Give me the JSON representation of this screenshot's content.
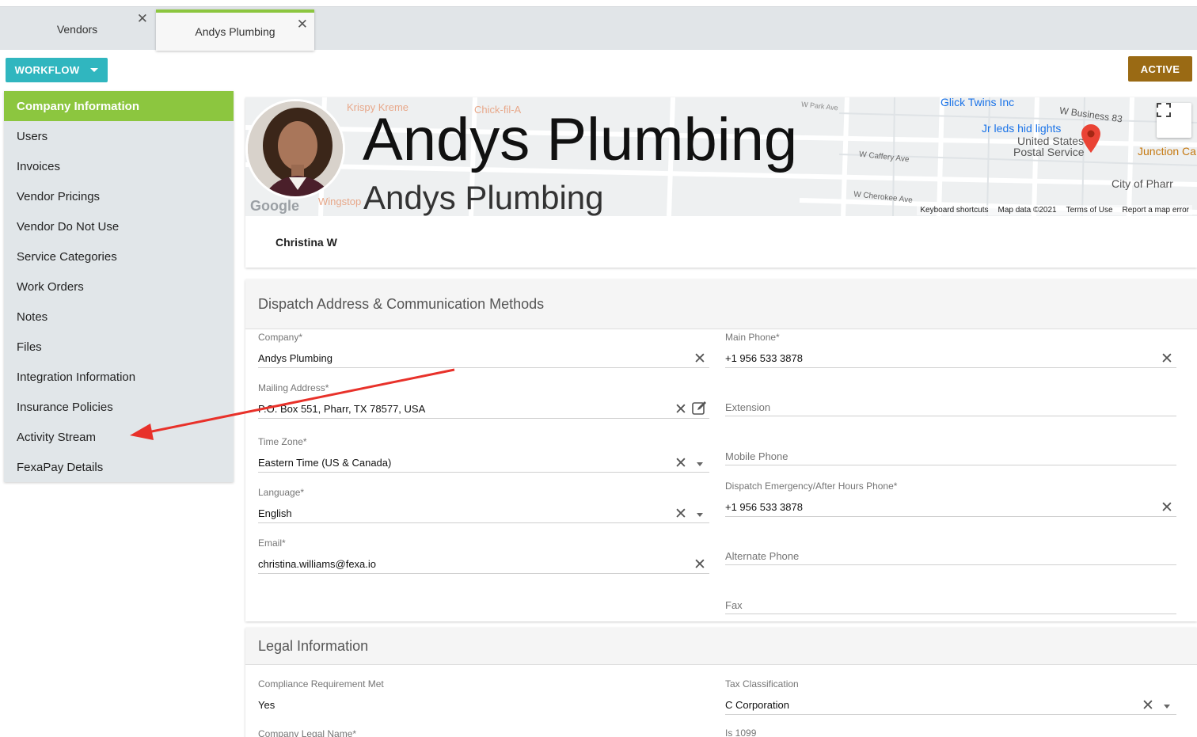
{
  "tabs": [
    {
      "label": "Vendors"
    },
    {
      "label": "Andys Plumbing"
    }
  ],
  "toolbar": {
    "workflow_label": "WORKFLOW",
    "status_label": "ACTIVE"
  },
  "sidebar": {
    "items": [
      {
        "label": "Company Information"
      },
      {
        "label": "Users"
      },
      {
        "label": "Invoices"
      },
      {
        "label": "Vendor Pricings"
      },
      {
        "label": "Vendor Do Not Use"
      },
      {
        "label": "Service Categories"
      },
      {
        "label": "Work Orders"
      },
      {
        "label": "Notes"
      },
      {
        "label": "Files"
      },
      {
        "label": "Integration Information"
      },
      {
        "label": "Insurance Policies"
      },
      {
        "label": "Activity Stream"
      },
      {
        "label": "FexaPay Details"
      }
    ]
  },
  "header": {
    "title": "Andys Plumbing",
    "subtitle": "Andys Plumbing",
    "contact_name": "Christina W"
  },
  "map": {
    "labels": {
      "krispy": "Krispy Kreme",
      "chick": "Chick-fil-A",
      "glick": "Glick Twins Inc",
      "jrleds": "Jr leds hid lights",
      "usps1": "United States",
      "usps2": "Postal Service",
      "junction": "Junction Ca",
      "cityofpharr": "City of Pharr",
      "wingstop": "Wingstop",
      "wbusiness": "W Business 83",
      "wcaffery": "W Caffery Ave",
      "wcherokee": "W Cherokee Ave",
      "wpark": "W Park Ave",
      "google": "Google"
    },
    "footer": {
      "shortcuts": "Keyboard shortcuts",
      "mapdata": "Map data ©2021",
      "terms": "Terms of Use",
      "report": "Report a map error"
    }
  },
  "dispatch": {
    "title": "Dispatch Address & Communication Methods",
    "company": {
      "label": "Company*",
      "value": "Andys Plumbing"
    },
    "mailing": {
      "label": "Mailing Address*",
      "value": "P.O. Box 551, Pharr, TX 78577, USA"
    },
    "timezone": {
      "label": "Time Zone*",
      "value": "Eastern Time (US & Canada)"
    },
    "language": {
      "label": "Language*",
      "value": "English"
    },
    "email": {
      "label": "Email*",
      "value": "christina.williams@fexa.io"
    },
    "main_phone": {
      "label": "Main Phone*",
      "value": "+1 956 533 3878"
    },
    "extension": {
      "placeholder": "Extension"
    },
    "mobile": {
      "placeholder": "Mobile Phone"
    },
    "emergency": {
      "label": "Dispatch Emergency/After Hours Phone*",
      "value": "+1 956 533 3878"
    },
    "alternate": {
      "placeholder": "Alternate Phone"
    },
    "fax": {
      "placeholder": "Fax"
    }
  },
  "legal": {
    "title": "Legal Information",
    "compliance": {
      "label": "Compliance Requirement Met",
      "value": "Yes"
    },
    "tax": {
      "label": "Tax Classification",
      "value": "C Corporation"
    },
    "legal_name": {
      "label": "Company Legal Name*"
    },
    "is1099": {
      "label": "Is 1099"
    }
  },
  "colors": {
    "accent_green": "#8cc63f",
    "workflow_teal": "#30b6bf",
    "status_brown": "#9a6a14",
    "annotation_red": "#e8312a"
  }
}
